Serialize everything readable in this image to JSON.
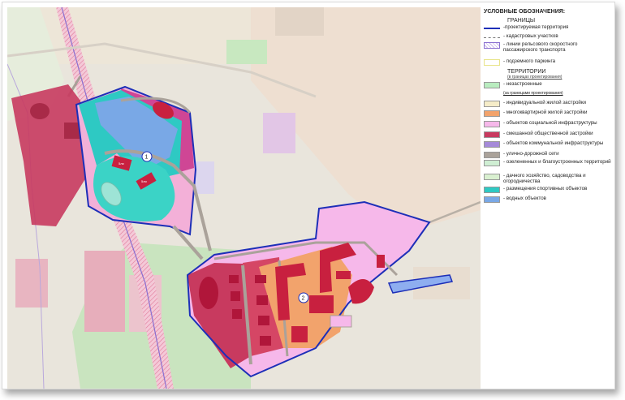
{
  "legend": {
    "title": "УСЛОВНЫЕ ОБОЗНАЧЕНИЯ:",
    "boundaries_heading": "ГРАНИЦЫ",
    "boundaries": [
      {
        "label": "-проектируемая территория",
        "style": "line",
        "color": "#1d2fb8"
      },
      {
        "label": "- кадастровых участков",
        "style": "dash",
        "color": "#777777"
      },
      {
        "label": "- линии рельсового скоростного пассажирского транспорта",
        "style": "hatch",
        "color": "#8a6fd0"
      },
      {
        "label": "- подземного паркинга",
        "style": "park",
        "color": "#e8e48a"
      }
    ],
    "territories_heading": "ТЕРРИТОРИИ",
    "territories_sub": "(в границах проектирования)",
    "territories": [
      {
        "label": "- незастроенные",
        "color": "#b9ecbf"
      },
      {
        "label": "(за границами проектирования)",
        "color": null
      },
      {
        "label": "- индивидуальной жилой застройки",
        "color": "#f5ecc8"
      },
      {
        "label": "- многоквартирной жилой застройки",
        "color": "#f2a36c"
      },
      {
        "label": "- объектов социальной инфраструктуры",
        "color": "#f6b8ea"
      },
      {
        "label": "- смешанной общественной застройки",
        "color": "#c83a5f"
      },
      {
        "label": "- объектов коммунальной инфраструктуры",
        "color": "#a58ad8"
      },
      {
        "label": "- улично-дорожной сети",
        "color": "#aaa29a"
      },
      {
        "label": "- озелененных и благоустроенных территорий",
        "color": "#cfeed3"
      },
      {
        "label": "- дачного хозяйство, садоводства и огородничества",
        "color": "#d9f0d0"
      },
      {
        "label": "- размещения спортивных объектов",
        "color": "#2ec9c3"
      },
      {
        "label": "- водных объектов",
        "color": "#79a8e6"
      }
    ]
  },
  "map": {
    "markers": [
      "1",
      "2"
    ],
    "colors": {
      "project_boundary": "#1d2fb8",
      "mixed_public": "#c83a5f",
      "multi_apartment": "#f2a36c",
      "social": "#f6b8ea",
      "sport": "#2ec9c3",
      "water": "#79a8e6",
      "road": "#aaa29a",
      "communal": "#a58ad8"
    }
  }
}
